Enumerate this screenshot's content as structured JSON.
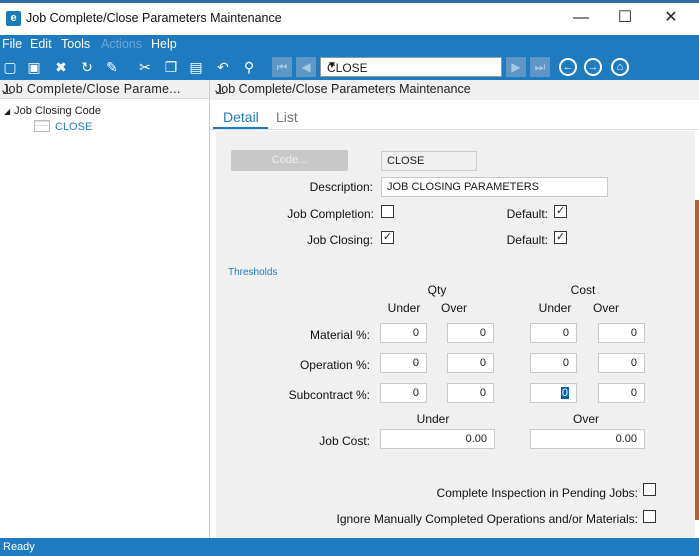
{
  "window": {
    "app_icon": "e",
    "title": "Job Complete/Close Parameters Maintenance",
    "minimize": "—",
    "maximize": "☐",
    "close": "✕"
  },
  "menu": [
    {
      "label": "File",
      "enabled": true
    },
    {
      "label": "Edit",
      "enabled": true
    },
    {
      "label": "Tools",
      "enabled": true
    },
    {
      "label": "Actions",
      "enabled": false
    },
    {
      "label": "Help",
      "enabled": true
    }
  ],
  "toolbar": {
    "icons": [
      "new-icon",
      "save-icon",
      "delete-icon",
      "refresh-icon",
      "clear-icon",
      "cut-icon",
      "copy-icon",
      "paste-icon",
      "undo-icon",
      "search-icon"
    ],
    "nav_combo_value": "CLOSE",
    "circle_icons": [
      "back-icon",
      "forward-icon",
      "home-icon"
    ]
  },
  "tree": {
    "header": "Job Complete/Close Parame...",
    "root_label": "Job Closing Code",
    "root_toggle": "◢",
    "child_label": "CLOSE"
  },
  "content": {
    "header": "Job Complete/Close Parameters Maintenance",
    "tabs": [
      {
        "label": "Detail"
      },
      {
        "label": "List"
      }
    ],
    "code_button": "Code...",
    "code_value": "CLOSE",
    "description_label": "Description:",
    "description_value": "JOB CLOSING PARAMETERS",
    "job_completion_label": "Job Completion:",
    "job_completion_checked": false,
    "job_completion_default_label": "Default:",
    "job_completion_default_checked": true,
    "job_closing_label": "Job Closing:",
    "job_closing_checked": true,
    "job_closing_default_label": "Default:",
    "job_closing_default_checked": true,
    "thresholds_title": "Thresholds",
    "qty_label": "Qty",
    "cost_label": "Cost",
    "under_label": "Under",
    "over_label": "Over",
    "rows": [
      {
        "label": "Material %:",
        "qty_under": "0",
        "qty_over": "0",
        "cost_under": "0",
        "cost_over": "0"
      },
      {
        "label": "Operation %:",
        "qty_under": "0",
        "qty_over": "0",
        "cost_under": "0",
        "cost_over": "0"
      },
      {
        "label": "Subcontract %:",
        "qty_under": "0",
        "qty_over": "0",
        "cost_under": "0",
        "cost_over": "0"
      }
    ],
    "job_cost_label": "Job Cost:",
    "job_cost_under": "0.00",
    "job_cost_over": "0.00",
    "complete_inspection_label": "Complete Inspection in Pending Jobs:",
    "complete_inspection_checked": false,
    "ignore_manual_label": "Ignore Manually Completed Operations and/or Materials:",
    "ignore_manual_checked": false
  },
  "status": "Ready",
  "colors": {
    "accent": "#1e7bbf",
    "link": "#1f7bc0",
    "form_bg": "#f0f0f0"
  }
}
